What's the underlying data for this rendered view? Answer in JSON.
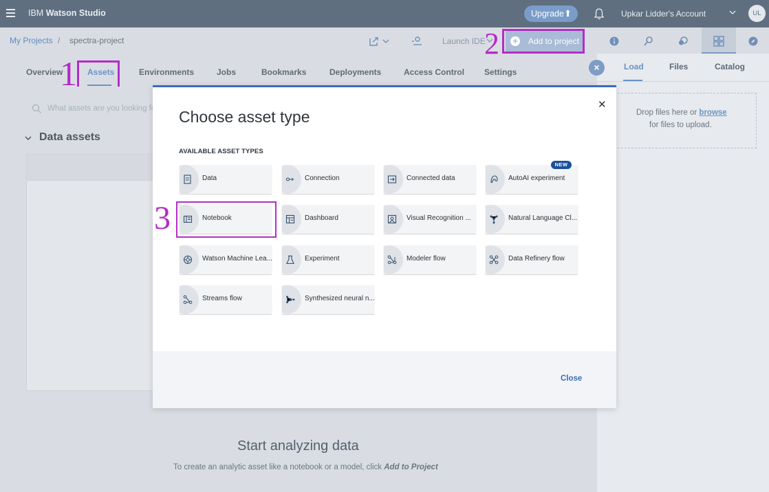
{
  "topbar": {
    "brand_prefix": "IBM",
    "brand_name": "Watson Studio",
    "upgrade_label": "Upgrade",
    "account_name": "Upkar Lidder's Account",
    "avatar_initials": "UL"
  },
  "breadcrumb": {
    "root": "My Projects",
    "separator": "/",
    "current": "spectra-project"
  },
  "actions": {
    "launch_ide": "Launch IDE",
    "add_to_project": "Add to project"
  },
  "tabs": [
    "Overview",
    "Assets",
    "Environments",
    "Jobs",
    "Bookmarks",
    "Deployments",
    "Access Control",
    "Settings"
  ],
  "active_tab": "Assets",
  "annotations": [
    "1",
    "2",
    "3"
  ],
  "main": {
    "search_placeholder": "What assets are you looking for",
    "data_assets_title": "Data assets",
    "empty_title": "Start analyzing data",
    "empty_text": "To create an analytic asset like a notebook or a model, click ",
    "empty_text_em": "Add to Project"
  },
  "right_panel": {
    "tabs": [
      "Load",
      "Files",
      "Catalog"
    ],
    "drop_text": "Drop files here or",
    "browse_link": "browse",
    "drop_text_2": "for files to upload."
  },
  "modal": {
    "title": "Choose asset type",
    "section_label": "AVAILABLE ASSET TYPES",
    "close_label": "Close",
    "new_badge": "NEW",
    "asset_types": [
      {
        "label": "Data",
        "icon": "data-icon"
      },
      {
        "label": "Connection",
        "icon": "connection-icon"
      },
      {
        "label": "Connected data",
        "icon": "connected-data-icon"
      },
      {
        "label": "AutoAI experiment",
        "icon": "autoai-icon"
      },
      {
        "label": "Notebook",
        "icon": "notebook-icon"
      },
      {
        "label": "Dashboard",
        "icon": "dashboard-icon"
      },
      {
        "label": "Visual Recognition ...",
        "icon": "visual-recognition-icon"
      },
      {
        "label": "Natural Language Cl...",
        "icon": "natural-language-icon"
      },
      {
        "label": "Watson Machine Lea...",
        "icon": "machine-learning-icon"
      },
      {
        "label": "Experiment",
        "icon": "experiment-icon"
      },
      {
        "label": "Modeler flow",
        "icon": "modeler-flow-icon"
      },
      {
        "label": "Data Refinery flow",
        "icon": "data-refinery-icon"
      },
      {
        "label": "Streams flow",
        "icon": "streams-flow-icon"
      },
      {
        "label": "Synthesized neural n...",
        "icon": "neural-network-icon"
      }
    ]
  }
}
